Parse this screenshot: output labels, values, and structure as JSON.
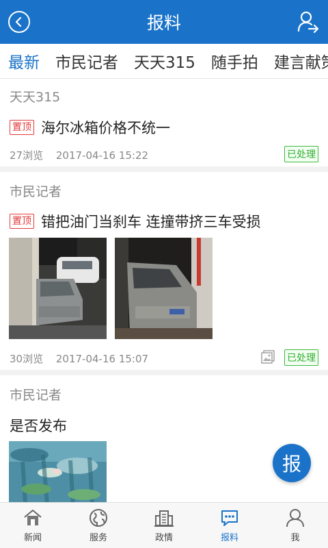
{
  "header": {
    "title": "报料"
  },
  "tabs": [
    {
      "label": "最新",
      "active": true
    },
    {
      "label": "市民记者"
    },
    {
      "label": "天天315"
    },
    {
      "label": "随手拍"
    },
    {
      "label": "建言献策"
    }
  ],
  "feed": [
    {
      "category": "天天315",
      "pinned_label": "置顶",
      "title": "海尔冰箱价格不统一",
      "views": "27浏览",
      "time": "2017-04-16 15:22",
      "status": "已处理"
    },
    {
      "category": "市民记者",
      "pinned_label": "置顶",
      "title": "错把油门当刹车 连撞带挤三车受损",
      "views": "30浏览",
      "time": "2017-04-16 15:07",
      "status": "已处理",
      "has_images_icon": "image-gallery-icon"
    },
    {
      "category": "市民记者",
      "title": "是否发布"
    }
  ],
  "fab": {
    "label": "报"
  },
  "bottom_nav": [
    {
      "label": "新闻",
      "icon": "home-icon"
    },
    {
      "label": "服务",
      "icon": "globe-icon"
    },
    {
      "label": "政情",
      "icon": "building-icon"
    },
    {
      "label": "报料",
      "icon": "chat-icon",
      "active": true
    },
    {
      "label": "我",
      "icon": "person-icon"
    }
  ],
  "colors": {
    "primary": "#1a73c9",
    "pin": "#e23b3b",
    "status": "#2fae2f"
  }
}
